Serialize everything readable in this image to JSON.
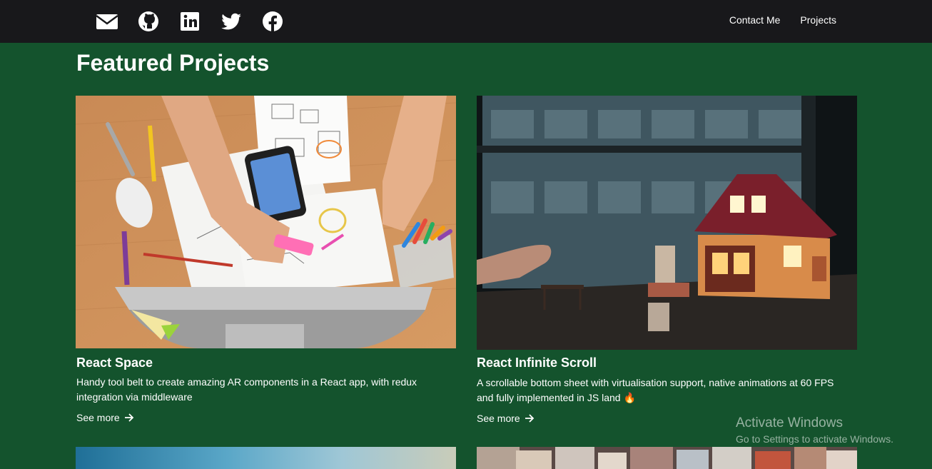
{
  "header": {
    "social": [
      {
        "name": "email-icon"
      },
      {
        "name": "github-icon"
      },
      {
        "name": "linkedin-icon"
      },
      {
        "name": "twitter-icon"
      },
      {
        "name": "facebook-icon"
      }
    ],
    "nav": [
      "Contact Me",
      "Projects"
    ]
  },
  "page": {
    "title": "Featured Projects"
  },
  "projects": [
    {
      "title": "React Space",
      "description": "Handy tool belt to create amazing AR components in a React app, with redux integration via middleware",
      "link": "See more"
    },
    {
      "title": "React Infinite Scroll",
      "description": "A scrollable bottom sheet with virtualisation support, native animations at 60 FPS and fully implemented in JS land 🔥",
      "link": "See more"
    }
  ],
  "watermark": {
    "line1": "Activate Windows",
    "line2": "Go to Settings to activate Windows."
  },
  "colors": {
    "background": "#14532d",
    "topbar": "#18181b"
  }
}
